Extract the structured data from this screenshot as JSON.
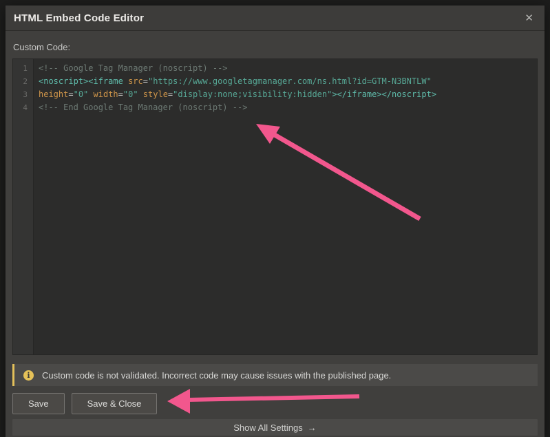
{
  "dialog": {
    "title": "HTML Embed Code Editor",
    "close_icon": "✕",
    "custom_code_label": "Custom Code:"
  },
  "editor": {
    "lines": [
      {
        "number": "1",
        "segments": [
          {
            "type": "comment",
            "text": "<!-- Google Tag Manager (noscript) -->"
          }
        ]
      },
      {
        "number": "2",
        "segments": [
          {
            "type": "tag",
            "text": "<noscript><iframe"
          },
          {
            "type": "plain",
            "text": " "
          },
          {
            "type": "attr",
            "text": "src"
          },
          {
            "type": "plain",
            "text": "="
          },
          {
            "type": "string",
            "text": "\"https://www.googletagmanager.com/ns.html?id=GTM-N3BNTLW\""
          }
        ]
      },
      {
        "number": "3",
        "segments": [
          {
            "type": "attr",
            "text": "height"
          },
          {
            "type": "plain",
            "text": "="
          },
          {
            "type": "string",
            "text": "\"0\""
          },
          {
            "type": "plain",
            "text": " "
          },
          {
            "type": "attr",
            "text": "width"
          },
          {
            "type": "plain",
            "text": "="
          },
          {
            "type": "string",
            "text": "\"0\""
          },
          {
            "type": "plain",
            "text": " "
          },
          {
            "type": "attr",
            "text": "style"
          },
          {
            "type": "plain",
            "text": "="
          },
          {
            "type": "string",
            "text": "\"display:none;visibility:hidden\""
          },
          {
            "type": "tag",
            "text": "></iframe></noscript>"
          }
        ]
      },
      {
        "number": "4",
        "segments": [
          {
            "type": "comment",
            "text": "<!-- End Google Tag Manager (noscript) -->"
          }
        ]
      }
    ]
  },
  "warning": {
    "icon_glyph": "i",
    "text": "Custom code is not validated. Incorrect code may cause issues with the published page."
  },
  "actions": {
    "save_label": "Save",
    "save_close_label": "Save & Close"
  },
  "footer": {
    "show_all_settings_label": "Show All Settings",
    "arrow_icon": "→"
  },
  "colors": {
    "syntax_comment": "#6d7a74",
    "syntax_tag": "#5fbcab",
    "syntax_attr": "#d0964a",
    "syntax_string": "#57a896",
    "warning_accent": "#e3c05a",
    "annotation_arrow": "#f2578d"
  }
}
